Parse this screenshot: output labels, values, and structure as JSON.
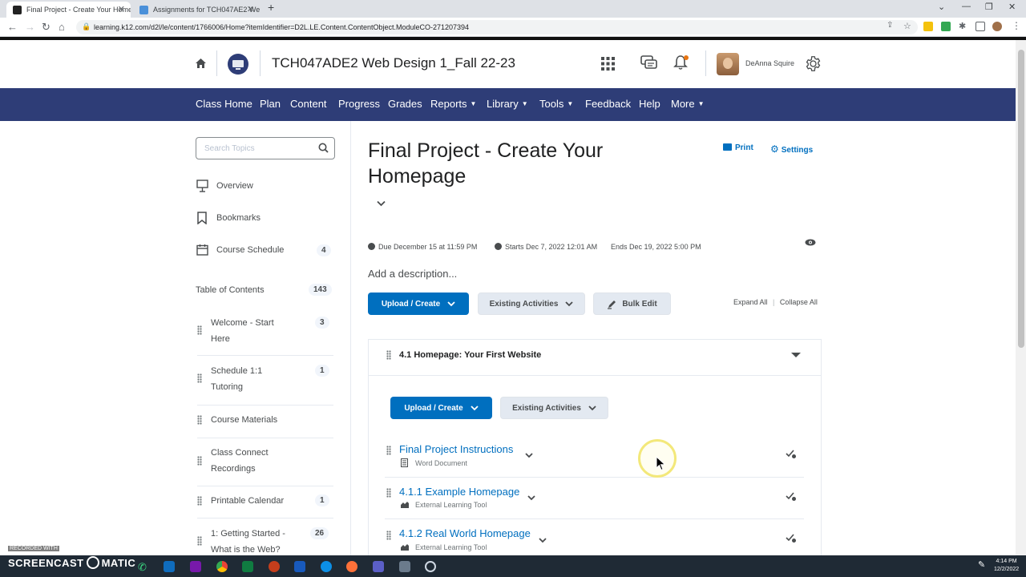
{
  "browser": {
    "tabs": [
      {
        "title": "Final Project - Create Your Home",
        "active": true
      },
      {
        "title": "Assignments for TCH047AE2 We",
        "active": false
      }
    ],
    "url": "learning.k12.com/d2l/le/content/1766006/Home?itemIdentifier=D2L.LE.Content.ContentObject.ModuleCO-271207394"
  },
  "header": {
    "course_title": "TCH047ADE2 Web Design 1_Fall 22-23",
    "user_name": "DeAnna Squire"
  },
  "nav": {
    "items": [
      {
        "label": "Class Home",
        "caret": false
      },
      {
        "label": "Plan",
        "caret": false
      },
      {
        "label": "Content",
        "caret": false
      },
      {
        "label": "Progress",
        "caret": false
      },
      {
        "label": "Grades",
        "caret": false
      },
      {
        "label": "Reports",
        "caret": true
      },
      {
        "label": "Library",
        "caret": true
      },
      {
        "label": "Tools",
        "caret": true
      },
      {
        "label": "Feedback",
        "caret": false
      },
      {
        "label": "Help",
        "caret": false
      },
      {
        "label": "More",
        "caret": true
      }
    ]
  },
  "sidebar": {
    "search_placeholder": "Search Topics",
    "overview": "Overview",
    "bookmarks": "Bookmarks",
    "course_schedule": "Course Schedule",
    "course_schedule_count": "4",
    "toc_label": "Table of Contents",
    "toc_count": "143",
    "toc_items": [
      {
        "label": "Welcome - Start Here",
        "count": "3"
      },
      {
        "label": "Schedule 1:1 Tutoring",
        "count": "1"
      },
      {
        "label": "Course Materials",
        "count": ""
      },
      {
        "label": "Class Connect Recordings",
        "count": ""
      },
      {
        "label": "Printable Calendar",
        "count": "1"
      },
      {
        "label": "1: Getting Started - What is the Web?",
        "count": "26"
      }
    ]
  },
  "main": {
    "title": "Final Project - Create Your Homepage",
    "print": "Print",
    "settings": "Settings",
    "due": "Due December 15 at 11:59 PM",
    "starts": "Starts Dec 7, 2022 12:01 AM",
    "ends": "Ends Dec 19, 2022 5:00 PM",
    "description_placeholder": "Add a description...",
    "upload_create": "Upload / Create",
    "existing_activities": "Existing Activities",
    "bulk_edit": "Bulk Edit",
    "expand_all": "Expand All",
    "collapse_all": "Collapse All",
    "module": {
      "title": "4.1 Homepage: Your First Website",
      "upload_create": "Upload / Create",
      "existing_activities": "Existing Activities",
      "topics": [
        {
          "title": "Final Project Instructions",
          "type": "Word Document"
        },
        {
          "title": "4.1.1 Example Homepage",
          "type": "External Learning Tool"
        },
        {
          "title": "4.1.2 Real World Homepage",
          "type": "External Learning Tool"
        }
      ]
    }
  },
  "taskbar": {
    "time": "4:14 PM",
    "date": "12/2/2022",
    "watermark_small": "RECORDED WITH",
    "watermark_brand": "SCREENCAST",
    "watermark_brand2": "MATIC"
  }
}
